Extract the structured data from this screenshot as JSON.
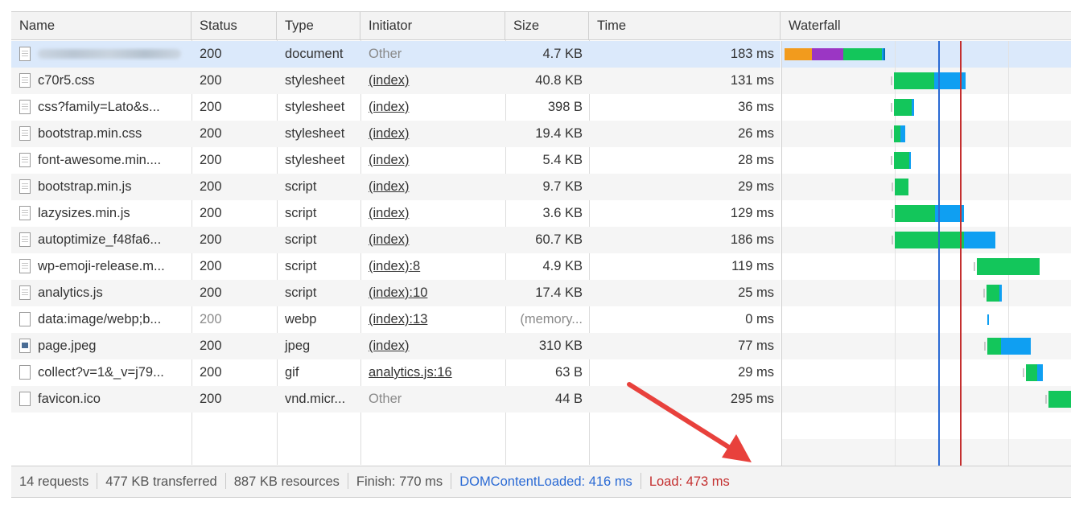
{
  "columns": {
    "name": "Name",
    "status": "Status",
    "type": "Type",
    "initiator": "Initiator",
    "size": "Size",
    "time": "Time",
    "waterfall": "Waterfall"
  },
  "rows": [
    {
      "name": "",
      "redacted": true,
      "icon": "document-icon",
      "status": "200",
      "type": "document",
      "initiator": "Other",
      "initiator_link": false,
      "size": "4.7 KB",
      "time": "183 ms",
      "selected": true
    },
    {
      "name": "c70r5.css",
      "icon": "document-icon",
      "status": "200",
      "type": "stylesheet",
      "initiator": "(index)",
      "initiator_link": true,
      "size": "40.8 KB",
      "time": "131 ms"
    },
    {
      "name": "css?family=Lato&s...",
      "icon": "document-icon",
      "status": "200",
      "type": "stylesheet",
      "initiator": "(index)",
      "initiator_link": true,
      "size": "398 B",
      "time": "36 ms"
    },
    {
      "name": "bootstrap.min.css",
      "icon": "document-icon",
      "status": "200",
      "type": "stylesheet",
      "initiator": "(index)",
      "initiator_link": true,
      "size": "19.4 KB",
      "time": "26 ms"
    },
    {
      "name": "font-awesome.min....",
      "icon": "document-icon",
      "status": "200",
      "type": "stylesheet",
      "initiator": "(index)",
      "initiator_link": true,
      "size": "5.4 KB",
      "time": "28 ms"
    },
    {
      "name": "bootstrap.min.js",
      "icon": "document-icon",
      "status": "200",
      "type": "script",
      "initiator": "(index)",
      "initiator_link": true,
      "size": "9.7 KB",
      "time": "29 ms"
    },
    {
      "name": "lazysizes.min.js",
      "icon": "document-icon",
      "status": "200",
      "type": "script",
      "initiator": "(index)",
      "initiator_link": true,
      "size": "3.6 KB",
      "time": "129 ms"
    },
    {
      "name": "autoptimize_f48fa6...",
      "icon": "document-icon",
      "status": "200",
      "type": "script",
      "initiator": "(index)",
      "initiator_link": true,
      "size": "60.7 KB",
      "time": "186 ms"
    },
    {
      "name": "wp-emoji-release.m...",
      "icon": "document-icon",
      "status": "200",
      "type": "script",
      "initiator": "(index):8",
      "initiator_link": true,
      "size": "4.9 KB",
      "time": "119 ms"
    },
    {
      "name": "analytics.js",
      "icon": "document-icon",
      "status": "200",
      "type": "script",
      "initiator": "(index):10",
      "initiator_link": true,
      "size": "17.4 KB",
      "time": "25 ms"
    },
    {
      "name": "data:image/webp;b...",
      "icon": "blank-file-icon",
      "status": "200",
      "status_grey": true,
      "type": "webp",
      "initiator": "(index):13",
      "initiator_link": true,
      "size": "(memory...",
      "size_grey": true,
      "time": "0 ms"
    },
    {
      "name": "page.jpeg",
      "icon": "image-icon",
      "status": "200",
      "type": "jpeg",
      "initiator": "(index)",
      "initiator_link": true,
      "size": "310 KB",
      "time": "77 ms"
    },
    {
      "name": "collect?v=1&_v=j79...",
      "icon": "blank-file-icon",
      "status": "200",
      "type": "gif",
      "initiator": "analytics.js:16",
      "initiator_link": true,
      "size": "63 B",
      "time": "29 ms"
    },
    {
      "name": "favicon.ico",
      "icon": "blank-file-icon",
      "status": "200",
      "type": "vnd.micr...",
      "initiator": "Other",
      "initiator_link": false,
      "size": "44 B",
      "time": "295 ms"
    }
  ],
  "waterfall": {
    "total_ms": 770,
    "dom_content_loaded_ms": 416,
    "load_ms": 473,
    "colors": {
      "queue": "#f29b1d",
      "ssl": "#9b36c4",
      "wait": "#13c65b",
      "download": "#0f9ff2",
      "stall": "#c8c8c8",
      "dom_line": "#2a6ad4",
      "load_line": "#c42f2f"
    }
  },
  "footer": {
    "requests": "14 requests",
    "transferred": "477 KB transferred",
    "resources": "887 KB resources",
    "finish": "Finish: 770 ms",
    "dom_content_loaded": "DOMContentLoaded: 416 ms",
    "load": "Load: 473 ms"
  },
  "annotation": {
    "arrow_color": "#e8413c"
  }
}
